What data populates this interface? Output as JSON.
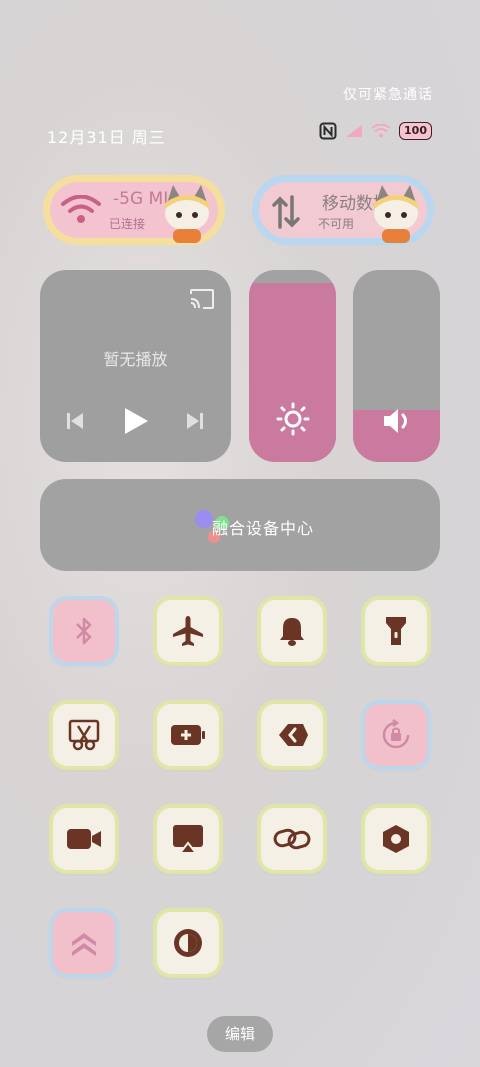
{
  "status_bar": {
    "emergency_text": "仅可紧急通话",
    "date_text": "12月31日 周三",
    "battery_text": "100"
  },
  "toggles": {
    "wifi": {
      "title": "-5G  MI",
      "subtitle": "已连接"
    },
    "mobile_data": {
      "title": "移动数据",
      "subtitle": "不可用"
    }
  },
  "media": {
    "now_playing": "暂无播放"
  },
  "sliders": {
    "brightness_level": 0.93,
    "volume_level": 0.27
  },
  "device_hub": {
    "label": "融合设备中心"
  },
  "colors": {
    "accent_pink": "#c97a9e",
    "tile_icon": "#6b3526",
    "panel_gray": "#a2a2a2"
  },
  "tiles": [
    {
      "name": "bluetooth",
      "icon": "bluetooth-icon",
      "active": true
    },
    {
      "name": "airplane-mode",
      "icon": "airplane-icon",
      "active": false
    },
    {
      "name": "sound",
      "icon": "bell-icon",
      "active": false
    },
    {
      "name": "flashlight",
      "icon": "flashlight-icon",
      "active": false
    },
    {
      "name": "screenshot",
      "icon": "scissors-icon",
      "active": false
    },
    {
      "name": "battery-saver",
      "icon": "battery-plus-icon",
      "active": false
    },
    {
      "name": "vpn",
      "icon": "chevron-code-icon",
      "active": false
    },
    {
      "name": "rotation-lock",
      "icon": "rotation-lock-icon",
      "active": true
    },
    {
      "name": "screen-record",
      "icon": "video-camera-icon",
      "active": false
    },
    {
      "name": "screen-cast",
      "icon": "cast-screen-icon",
      "active": false
    },
    {
      "name": "link-share",
      "icon": "link-icon",
      "active": false
    },
    {
      "name": "settings",
      "icon": "hex-nut-icon",
      "active": false
    },
    {
      "name": "performance",
      "icon": "double-chevron-up-icon",
      "active": true
    },
    {
      "name": "dark-mode",
      "icon": "contrast-icon",
      "active": false
    }
  ],
  "footer": {
    "edit_label": "编辑"
  }
}
